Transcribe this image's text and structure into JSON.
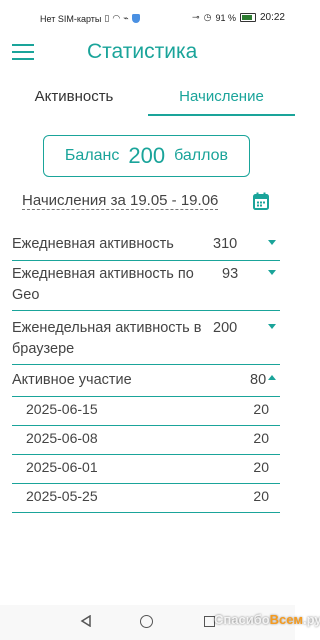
{
  "status_bar": {
    "carrier": "Нет SIM-карты",
    "battery": "91 %",
    "time": "20:22",
    "icons": [
      "nfc-icon",
      "wifi-icon",
      "key-icon",
      "alarm-icon",
      "shield-icon",
      "battery-icon"
    ]
  },
  "app": {
    "title": "Статистика",
    "accent_color": "#1aa49a"
  },
  "tabs": [
    {
      "label": "Активность",
      "active": false
    },
    {
      "label": "Начисление",
      "active": true
    }
  ],
  "balance": {
    "label": "Баланс",
    "value": "200",
    "unit": "баллов"
  },
  "period": {
    "label": "Начисления за 19.05 - 19.06"
  },
  "rows": [
    {
      "label": "Ежедневная активность",
      "value": "310",
      "expanded": false
    },
    {
      "label_line1": "Ежедневная активность по",
      "label_line2": "Geo",
      "value": "93",
      "expanded": false
    },
    {
      "label_line1": "Еженедельная активность в",
      "label_line2": "браузере",
      "value": "200",
      "expanded": false
    },
    {
      "label": "Активное участие",
      "value": "80",
      "expanded": true
    }
  ],
  "active_participation_items": [
    {
      "date": "2025-06-15",
      "value": "20"
    },
    {
      "date": "2025-06-08",
      "value": "20"
    },
    {
      "date": "2025-06-01",
      "value": "20"
    },
    {
      "date": "2025-05-25",
      "value": "20"
    }
  ],
  "watermark": {
    "part1": "Спасибо",
    "part2": "Всем",
    "part3": ".ру"
  }
}
